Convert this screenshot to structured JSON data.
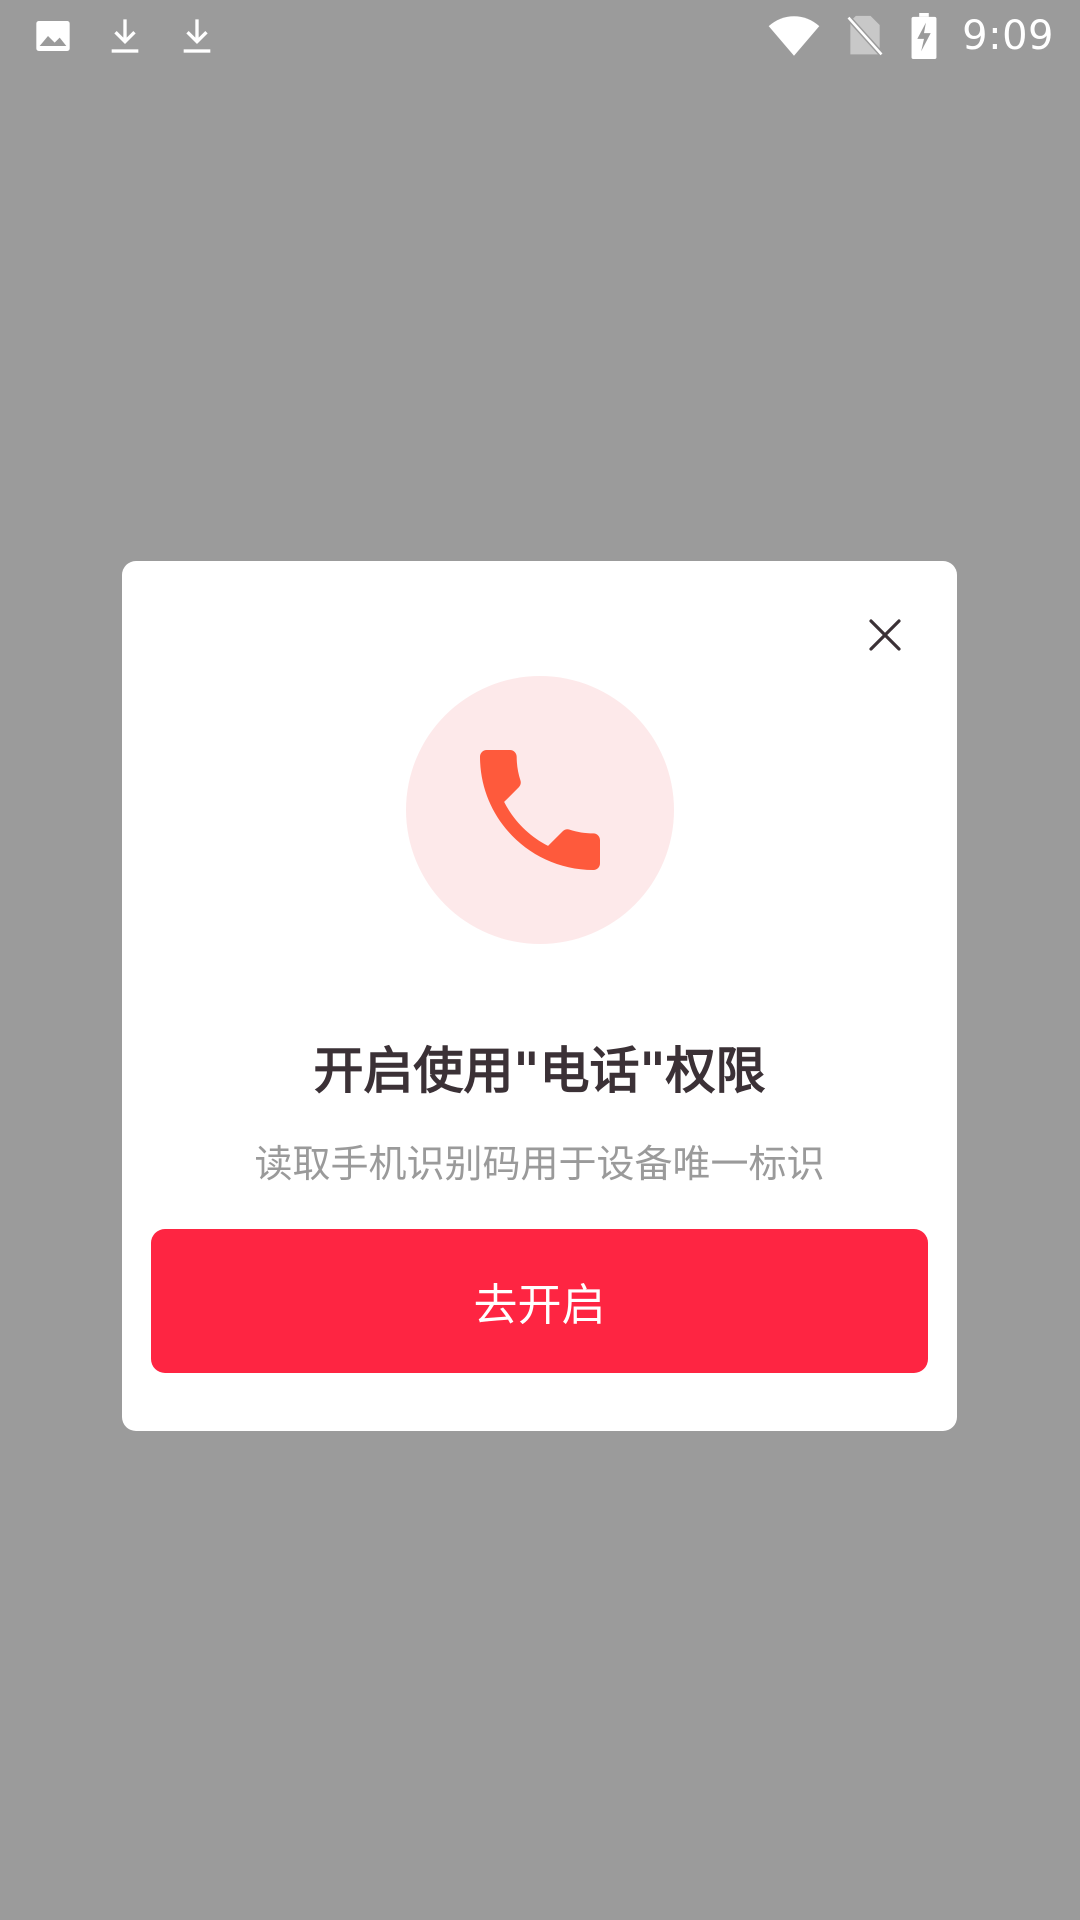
{
  "status_bar": {
    "time": "9:09",
    "left_icons": [
      "image-icon",
      "download-icon",
      "download-icon"
    ],
    "right_icons": [
      "wifi-icon",
      "no-sim-icon",
      "battery-charging-icon"
    ]
  },
  "dialog": {
    "icon": "phone-icon",
    "title": "开启使用\"电话\"权限",
    "description": "读取手机识别码用于设备唯一标识",
    "confirm_label": "去开启",
    "close_icon": "close-icon"
  },
  "colors": {
    "overlay": "#9b9b9b",
    "accent": "#fe2542",
    "icon_bg": "#fde9ea",
    "icon": "#fe5a3c",
    "title": "#3b3136",
    "description": "#9a9a9a"
  }
}
